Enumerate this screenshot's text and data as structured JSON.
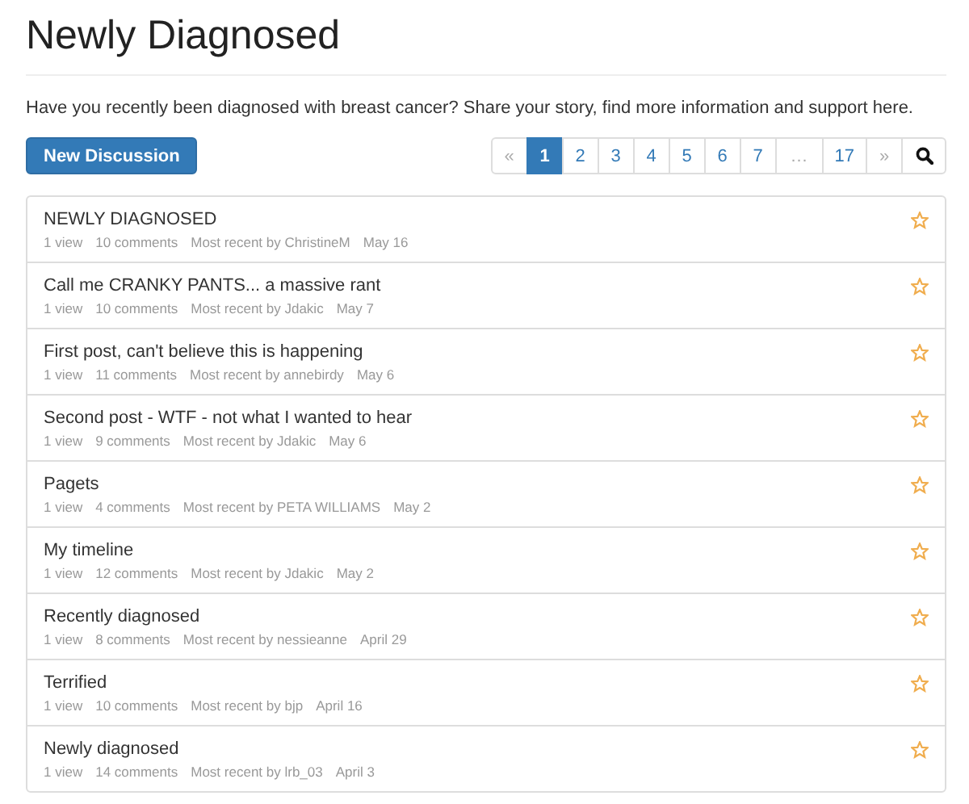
{
  "page": {
    "title": "Newly Diagnosed",
    "description": "Have you recently been diagnosed with breast cancer? Share your story, find more information and support here."
  },
  "new_button": "New Discussion",
  "pagination": [
    {
      "label": "«",
      "kind": "prev",
      "selected": false
    },
    {
      "label": "1",
      "kind": "page",
      "selected": true
    },
    {
      "label": "2",
      "kind": "page",
      "selected": false
    },
    {
      "label": "3",
      "kind": "page",
      "selected": false
    },
    {
      "label": "4",
      "kind": "page",
      "selected": false
    },
    {
      "label": "5",
      "kind": "page",
      "selected": false
    },
    {
      "label": "6",
      "kind": "page",
      "selected": false
    },
    {
      "label": "7",
      "kind": "page",
      "selected": false
    },
    {
      "label": "…",
      "kind": "ellipsis",
      "selected": false
    },
    {
      "label": "17",
      "kind": "page",
      "selected": false
    },
    {
      "label": "»",
      "kind": "next",
      "selected": false
    }
  ],
  "discussions": [
    {
      "title": "NEWLY DIAGNOSED",
      "views": "1 view",
      "comments": "10 comments",
      "recent": "Most recent by ChristineM",
      "date": "May 16",
      "bookmarked": false
    },
    {
      "title": "Call me CRANKY PANTS... a massive rant",
      "views": "1 view",
      "comments": "10 comments",
      "recent": "Most recent by Jdakic",
      "date": "May 7",
      "bookmarked": false
    },
    {
      "title": "First post, can't believe this is happening",
      "views": "1 view",
      "comments": "11 comments",
      "recent": "Most recent by annebirdy",
      "date": "May 6",
      "bookmarked": false
    },
    {
      "title": "Second post - WTF - not what I wanted to hear",
      "views": "1 view",
      "comments": "9 comments",
      "recent": "Most recent by Jdakic",
      "date": "May 6",
      "bookmarked": false
    },
    {
      "title": "Pagets",
      "views": "1 view",
      "comments": "4 comments",
      "recent": "Most recent by PETA WILLIAMS",
      "date": "May 2",
      "bookmarked": false
    },
    {
      "title": "My timeline",
      "views": "1 view",
      "comments": "12 comments",
      "recent": "Most recent by Jdakic",
      "date": "May 2",
      "bookmarked": false
    },
    {
      "title": "Recently diagnosed",
      "views": "1 view",
      "comments": "8 comments",
      "recent": "Most recent by nessieanne",
      "date": "April 29",
      "bookmarked": false
    },
    {
      "title": "Terrified",
      "views": "1 view",
      "comments": "10 comments",
      "recent": "Most recent by bjp",
      "date": "April 16",
      "bookmarked": false
    },
    {
      "title": "Newly diagnosed",
      "views": "1 view",
      "comments": "14 comments",
      "recent": "Most recent by lrb_03",
      "date": "April 3",
      "bookmarked": false
    }
  ]
}
